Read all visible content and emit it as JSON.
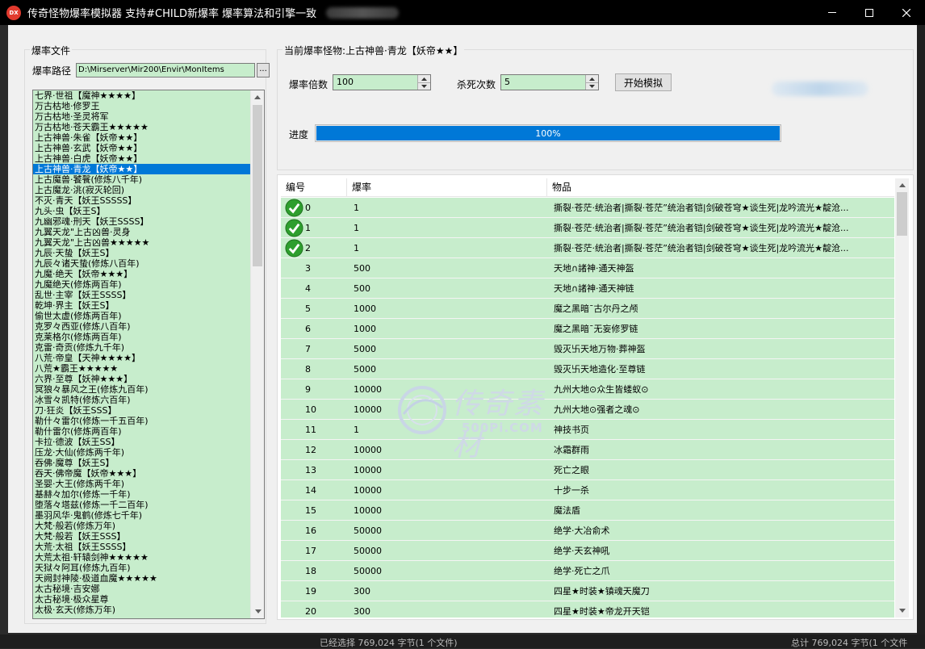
{
  "window": {
    "title": "传奇怪物爆率模拟器 支持#CHILD新爆率 爆率算法和引擎一致",
    "minimize_glyph": "–",
    "app_icon_text": "DX"
  },
  "left_group": {
    "title": "爆率文件",
    "path_label": "爆率路径",
    "path_value": "D:\\Mirserver\\Mir200\\Envir\\MonItems",
    "browse_label": "..."
  },
  "monsters": [
    "七界·世祖【魔神★★★★】",
    "万古枯地·修罗王",
    "万古枯地·圣灵将军",
    "万古枯地·苍天霸王★★★★★",
    "上古神兽·朱雀【妖帝★★】",
    "上古神兽·玄武【妖帝★★】",
    "上古神兽·白虎【妖帝★★】",
    "上古神兽·青龙【妖帝★★】",
    "上古魔兽·饕餮(修炼八千年)",
    "上古魔龙·洮(寂灭轮回)",
    "不灭·青天【妖王SSSSS】",
    "九头·虫【妖王S】",
    "九幽邪魂·刑天【妖王SSSS】",
    "九翼天龙\"上古凶兽·灵身",
    "九翼天龙\"上古凶兽★★★★★",
    "九辰·天蛰【妖王S】",
    "九辰々诸天蛰(修炼八百年)",
    "九魔·绝天【妖帝★★★】",
    "九魔绝天(修炼两百年)",
    "乱世·主宰【妖王SSSS】",
    "乾坤·界主【妖王S】",
    "偷世太虚(修炼两百年)",
    "克罗々西亚(修炼八百年)",
    "克莱格尔(修炼两百年)",
    "克雷·奇贡(修炼九千年)",
    "八荒·帝皇【天神★★★★】",
    "八荒★霸王★★★★★",
    "六界·至尊【妖神★★★】",
    "冥狼々暴风之王(修炼九百年)",
    "冰雪々凯特(修炼六百年)",
    "刀·狂炎【妖王SSS】",
    "勒什々雷尔(修炼一千五百年)",
    "勒什雷尔(修炼两百年)",
    "卡拉·德波【妖王SS】",
    "压龙·大仙(修炼两千年)",
    "吞佛·魔尊【妖王S】",
    "吞天·佛帝魔【妖帝★★★】",
    "圣婴·大王(修炼两千年)",
    "基赫々加尔(修炼一千年)",
    "堕落々塔兹(修炼一千二百年)",
    "墨羽风华·鬼鹤(修炼七千年)",
    "大梵·般若(修炼万年)",
    "大梵·般若【妖王SSS】",
    "大荒·太祖【妖王SSSS】",
    "大荒太祖·轩辕剑神★★★★★",
    "天狱々阿耳(修炼九百年)",
    "天阙封神陵·极道血魔★★★★★",
    "太古秘境·吉安娜",
    "太古秘境·极众星尊",
    "太极·玄天(修炼万年)"
  ],
  "selected_monster_index": 7,
  "right_group": {
    "title": "当前爆率怪物:上古神兽·青龙【妖帝★★】",
    "rate_label": "爆率倍数",
    "rate_value": "100",
    "kill_label": "杀死次数",
    "kill_value": "5",
    "start_button": "开始模拟",
    "progress_label": "进度",
    "progress_text": "100%",
    "progress_value": 1.0
  },
  "table": {
    "headers": [
      "编号",
      "爆率",
      "物品"
    ],
    "rows": [
      {
        "id": "0",
        "rate": "1",
        "item": "撕裂·苍茫·统治者|撕裂·苍茫”统治者铠|剑破苍穹★谈生死|龙吟流光★靛沧...",
        "hit": true
      },
      {
        "id": "1",
        "rate": "1",
        "item": "撕裂·苍茫·统治者|撕裂·苍茫”统治者铠|剑破苍穹★谈生死|龙吟流光★靛沧...",
        "hit": true
      },
      {
        "id": "2",
        "rate": "1",
        "item": "撕裂·苍茫·统治者|撕裂·苍茫”统治者铠|剑破苍穹★谈生死|龙吟流光★靛沧...",
        "hit": true
      },
      {
        "id": "3",
        "rate": "500",
        "item": "天地∩諸神·通天神盔",
        "hit": false
      },
      {
        "id": "4",
        "rate": "500",
        "item": "天地∩諸神·通天神链",
        "hit": false
      },
      {
        "id": "5",
        "rate": "1000",
        "item": "魔之黑暗¯古尔丹之颅",
        "hit": false
      },
      {
        "id": "6",
        "rate": "1000",
        "item": "魔之黑暗¯无妄修罗链",
        "hit": false
      },
      {
        "id": "7",
        "rate": "5000",
        "item": "毁灭卐天地万物·葬神盔",
        "hit": false
      },
      {
        "id": "8",
        "rate": "5000",
        "item": "毁灭卐天地造化·至尊链",
        "hit": false
      },
      {
        "id": "9",
        "rate": "10000",
        "item": "九州大地⊙众生皆蝼蚁⊙",
        "hit": false
      },
      {
        "id": "10",
        "rate": "10000",
        "item": "九州大地⊙强者之魂⊙",
        "hit": false
      },
      {
        "id": "11",
        "rate": "1",
        "item": "神技书页",
        "hit": false
      },
      {
        "id": "12",
        "rate": "10000",
        "item": "冰霜群雨",
        "hit": false
      },
      {
        "id": "13",
        "rate": "10000",
        "item": "死亡之眼",
        "hit": false
      },
      {
        "id": "14",
        "rate": "10000",
        "item": "十步一杀",
        "hit": false
      },
      {
        "id": "15",
        "rate": "10000",
        "item": "魔法盾",
        "hit": false
      },
      {
        "id": "16",
        "rate": "50000",
        "item": "绝学·大冶俞术",
        "hit": false
      },
      {
        "id": "17",
        "rate": "50000",
        "item": "绝学·天玄神吼",
        "hit": false
      },
      {
        "id": "18",
        "rate": "50000",
        "item": "绝学·死亡之爪",
        "hit": false
      },
      {
        "id": "19",
        "rate": "300",
        "item": "四星★时装★镇魂天魔刀",
        "hit": false
      },
      {
        "id": "20",
        "rate": "300",
        "item": "四星★时装★帝龙开天铠",
        "hit": false
      }
    ]
  },
  "watermark": {
    "main": "传奇素材",
    "sub": "500Pi.COM"
  },
  "taskbar": {
    "left_text": "已经选择 769,024 字节(1 个文件)",
    "right_text": "总计 769,024 字节(1 个文件"
  },
  "colors": {
    "list_bg": "#c7edcc",
    "accent": "#0078d7",
    "check": "#2e9e2e"
  }
}
